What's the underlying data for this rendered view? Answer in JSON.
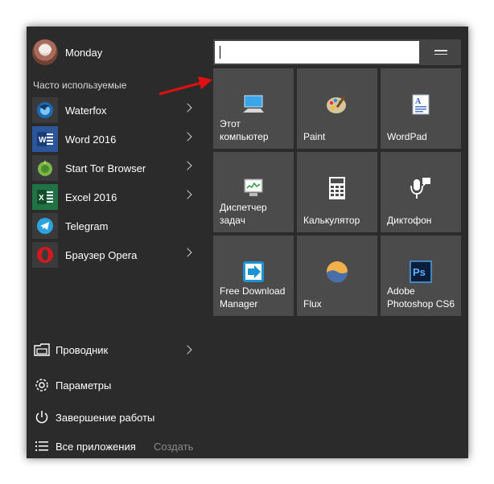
{
  "user": {
    "name": "Monday"
  },
  "frequent_label": "Часто используемые",
  "apps": [
    {
      "label": "Waterfox",
      "icon": "waterfox-icon",
      "has_arrow": true
    },
    {
      "label": "Word 2016",
      "icon": "word-icon",
      "has_arrow": true
    },
    {
      "label": "Start Tor Browser",
      "icon": "tor-icon",
      "has_arrow": true
    },
    {
      "label": "Excel 2016",
      "icon": "excel-icon",
      "has_arrow": true
    },
    {
      "label": "Telegram",
      "icon": "telegram-icon",
      "has_arrow": false
    },
    {
      "label": "Браузер Opera",
      "icon": "opera-icon",
      "has_arrow": true
    }
  ],
  "system": {
    "explorer": "Проводник",
    "settings": "Параметры",
    "shutdown": "Завершение работы",
    "all_apps": "Все приложения",
    "create": "Создать"
  },
  "search": {
    "value": ""
  },
  "tiles": [
    {
      "label": "Этот\nкомпьютер",
      "icon": "computer-icon"
    },
    {
      "label": "Paint",
      "icon": "paint-icon"
    },
    {
      "label": "WordPad",
      "icon": "wordpad-icon"
    },
    {
      "label": "Диспетчер\nзадач",
      "icon": "task-manager-icon"
    },
    {
      "label": "Калькулятор",
      "icon": "calculator-icon"
    },
    {
      "label": "Диктофон",
      "icon": "microphone-icon"
    },
    {
      "label": "Free Download\nManager",
      "icon": "fdm-icon"
    },
    {
      "label": "Flux",
      "icon": "flux-icon"
    },
    {
      "label": "Adobe\nPhotoshop CS6",
      "icon": "photoshop-icon"
    }
  ],
  "colors": {
    "menu_bg": "#2b2b2b",
    "tile_bg": "#4b4b4b",
    "arrow": "#e01010"
  }
}
